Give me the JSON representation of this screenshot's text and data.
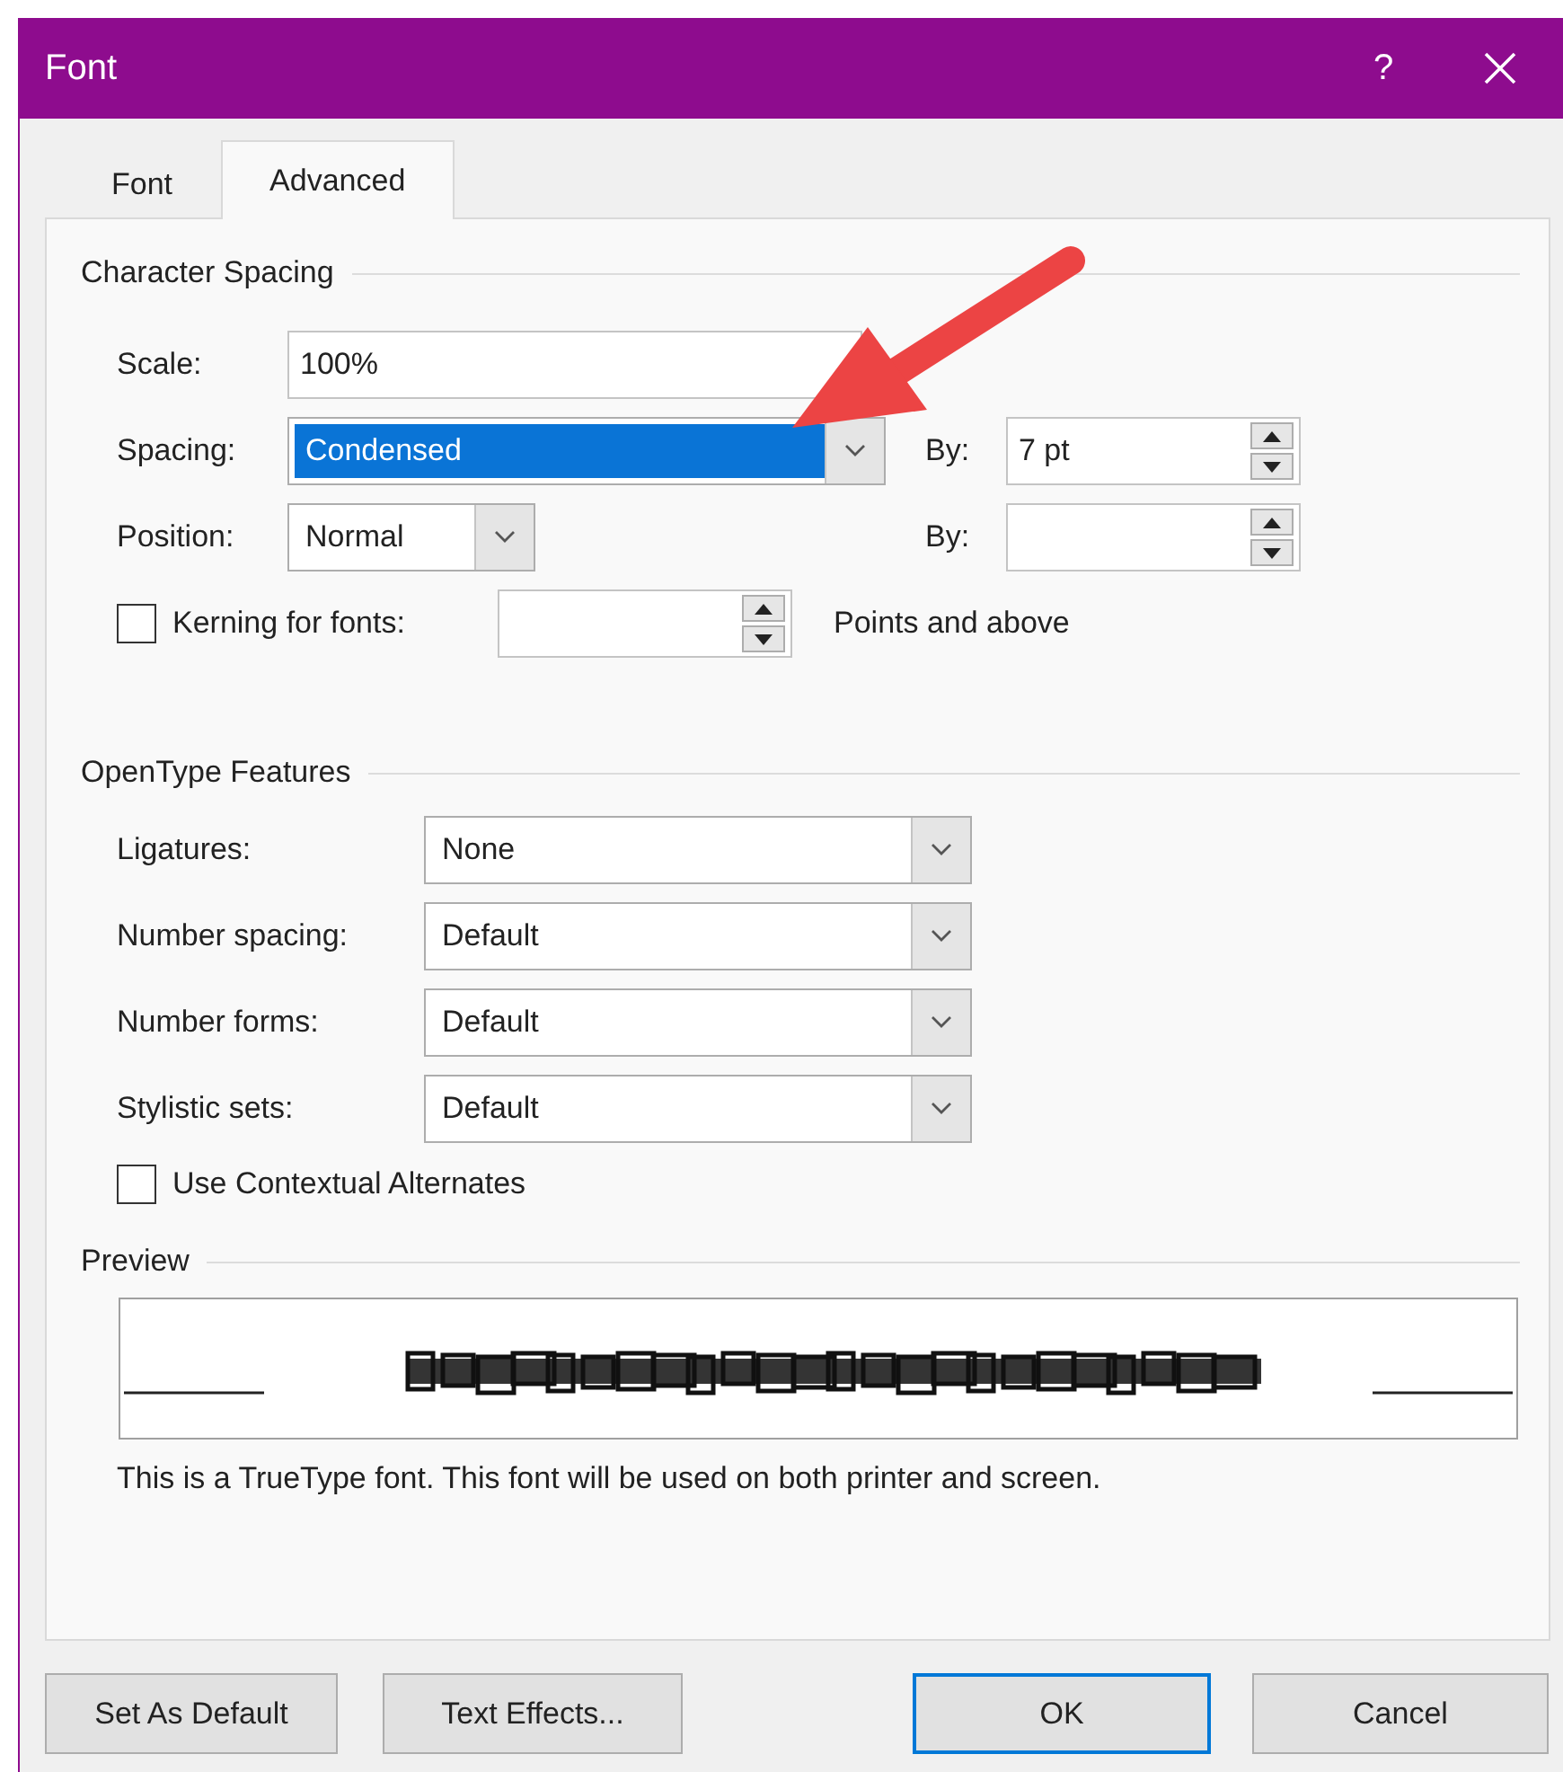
{
  "window": {
    "title": "Font",
    "help": "?"
  },
  "tabs": [
    {
      "label": "Font",
      "selected": false
    },
    {
      "label": "Advanced",
      "selected": true
    }
  ],
  "character_spacing": {
    "heading": "Character Spacing",
    "scale": {
      "label": "Scale:",
      "value": "100%"
    },
    "spacing": {
      "label": "Spacing:",
      "value": "Condensed",
      "selected": true,
      "by_label": "By:",
      "by_value": "7 pt"
    },
    "position": {
      "label": "Position:",
      "value": "Normal",
      "by_label": "By:"
    },
    "kerning": {
      "label": "Kerning for fonts:",
      "checked": false,
      "suffix": "Points and above"
    }
  },
  "opentype": {
    "heading": "OpenType Features",
    "rows": [
      {
        "label": "Ligatures:",
        "value": "None"
      },
      {
        "label": "Number spacing:",
        "value": "Default"
      },
      {
        "label": "Number forms:",
        "value": "Default"
      },
      {
        "label": "Stylistic sets:",
        "value": "Default"
      }
    ],
    "contextual": {
      "label": "Use Contextual Alternates",
      "checked": false
    }
  },
  "preview": {
    "heading": "Preview",
    "note": "This is a TrueType font. This font will be used on both printer and screen."
  },
  "buttons": [
    {
      "label": "Set As Default",
      "default": false
    },
    {
      "label": "Text Effects...",
      "default": false
    },
    {
      "label": "OK",
      "default": true
    },
    {
      "label": "Cancel",
      "default": false
    }
  ]
}
